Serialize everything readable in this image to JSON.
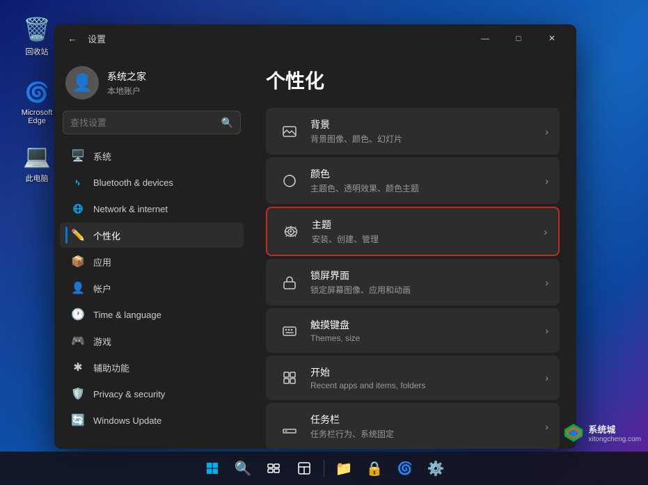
{
  "desktop": {
    "icons": [
      {
        "id": "recycle-bin",
        "label": "回收站",
        "icon": "🗑️"
      },
      {
        "id": "edge",
        "label": "Microsoft Edge",
        "icon": "🌐"
      },
      {
        "id": "this-pc",
        "label": "此电脑",
        "icon": "💻"
      }
    ]
  },
  "taskbar": {
    "icons": [
      {
        "id": "start",
        "icon": "⊞",
        "label": "开始"
      },
      {
        "id": "search",
        "icon": "🔍",
        "label": "搜索"
      },
      {
        "id": "taskview",
        "icon": "⬜",
        "label": "任务视图"
      },
      {
        "id": "widgets",
        "icon": "▦",
        "label": "小组件"
      },
      {
        "id": "explorer",
        "icon": "📁",
        "label": "文件资源管理器"
      },
      {
        "id": "lock",
        "icon": "🔒",
        "label": "锁"
      },
      {
        "id": "edge-tb",
        "icon": "🌐",
        "label": "Edge"
      },
      {
        "id": "settings-tb",
        "icon": "⚙️",
        "label": "设置"
      }
    ]
  },
  "window": {
    "title": "设置",
    "controls": {
      "minimize": "—",
      "maximize": "□",
      "close": "✕"
    }
  },
  "user": {
    "name": "系统之家",
    "subtitle": "本地账户",
    "avatar_icon": "👤"
  },
  "search": {
    "placeholder": "查找设置"
  },
  "sidebar": {
    "items": [
      {
        "id": "system",
        "label": "系统",
        "icon": "🖥️"
      },
      {
        "id": "bluetooth",
        "label": "Bluetooth & devices",
        "icon": "🔵"
      },
      {
        "id": "network",
        "label": "Network & internet",
        "icon": "🌐"
      },
      {
        "id": "personalization",
        "label": "个性化",
        "icon": "✏️",
        "active": true
      },
      {
        "id": "apps",
        "label": "应用",
        "icon": "📦"
      },
      {
        "id": "accounts",
        "label": "帐户",
        "icon": "👤"
      },
      {
        "id": "time",
        "label": "Time & language",
        "icon": "🕐"
      },
      {
        "id": "gaming",
        "label": "游戏",
        "icon": "🎮"
      },
      {
        "id": "accessibility",
        "label": "辅助功能",
        "icon": "♿"
      },
      {
        "id": "privacy",
        "label": "Privacy & security",
        "icon": "🛡️"
      },
      {
        "id": "update",
        "label": "Windows Update",
        "icon": "🔄"
      }
    ]
  },
  "panel": {
    "title": "个性化",
    "items": [
      {
        "id": "background",
        "icon": "🖼️",
        "title": "背景",
        "subtitle": "背景图像、颜色、幻灯片",
        "highlighted": false
      },
      {
        "id": "colors",
        "icon": "🎨",
        "title": "颜色",
        "subtitle": "主题色、透明效果、颜色主题",
        "highlighted": false
      },
      {
        "id": "themes",
        "icon": "✏️",
        "title": "主题",
        "subtitle": "安装、创建、管理",
        "highlighted": true
      },
      {
        "id": "lockscreen",
        "icon": "🖥️",
        "title": "锁屏界面",
        "subtitle": "锁定屏幕图像、应用和动画",
        "highlighted": false
      },
      {
        "id": "touchkeyboard",
        "icon": "⌨️",
        "title": "触摸键盘",
        "subtitle": "Themes, size",
        "highlighted": false
      },
      {
        "id": "start",
        "icon": "▦",
        "title": "开始",
        "subtitle": "Recent apps and items, folders",
        "highlighted": false
      },
      {
        "id": "taskbar",
        "icon": "▬",
        "title": "任务栏",
        "subtitle": "任务栏行为、系统固定",
        "highlighted": false
      }
    ]
  },
  "watermark": {
    "text": "系统城",
    "subtext": "xitongcheng.com"
  }
}
